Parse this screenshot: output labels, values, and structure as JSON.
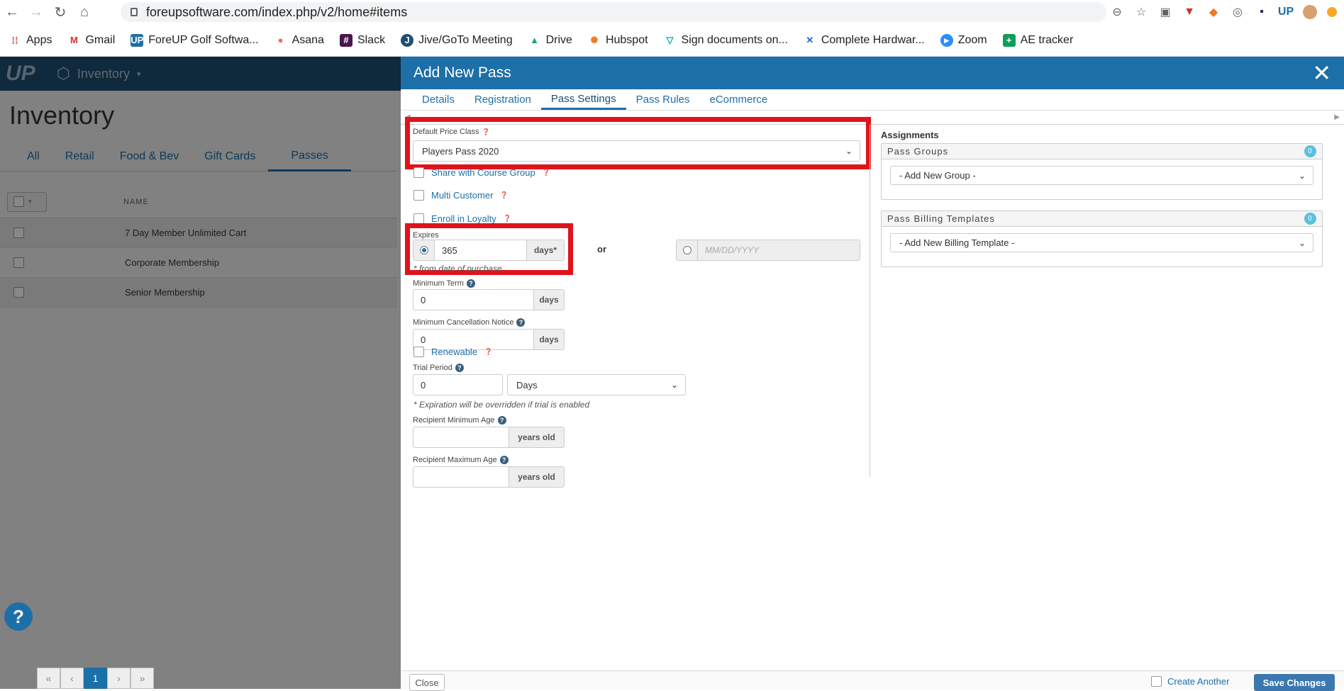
{
  "browser": {
    "url": "foreupsoftware.com/index.php/v2/home#items",
    "bookmarks": [
      "Apps",
      "Gmail",
      "ForeUP Golf Softwa...",
      "Asana",
      "Slack",
      "Jive/GoTo Meeting",
      "Drive",
      "Hubspot",
      "Sign documents on...",
      "Complete Hardwar...",
      "Zoom",
      "AE tracker"
    ]
  },
  "app": {
    "logo": "UP",
    "module_menu": "Inventory",
    "page_title": "Inventory",
    "category_tabs": [
      "All",
      "Retail",
      "Food & Bev",
      "Gift Cards",
      "Passes"
    ],
    "table": {
      "column_name": "NAME",
      "rows": [
        "7 Day Member Unlimited Cart",
        "Corporate Membership",
        "Senior Membership"
      ]
    },
    "pagination": {
      "current_page": "1"
    },
    "help": "?"
  },
  "modal": {
    "title": "Add New Pass",
    "tabs": [
      "Details",
      "Registration",
      "Pass Settings",
      "Pass Rules",
      "eCommerce"
    ],
    "default_price_class": {
      "label": "Default Price Class",
      "value": "Players Pass 2020"
    },
    "share_with_course_group": "Share with Course Group",
    "multi_customer": "Multi Customer",
    "enroll_in_loyalty": "Enroll in Loyalty",
    "expires": {
      "label": "Expires",
      "days_value": "365",
      "days_addon": "days*",
      "or": "or",
      "date_placeholder": "MM/DD/YYYY",
      "note": "* from date of purchase"
    },
    "minimum_term": {
      "label": "Minimum Term",
      "value": "0",
      "addon": "days"
    },
    "minimum_cancellation_notice": {
      "label": "Minimum Cancellation Notice",
      "value": "0",
      "addon": "days"
    },
    "renewable": "Renewable",
    "trial_period": {
      "label": "Trial Period",
      "value": "0",
      "unit": "Days",
      "note": "* Expiration will be overridden if trial is enabled"
    },
    "recipient_min_age": {
      "label": "Recipient Minimum Age",
      "value": "",
      "addon": "years old"
    },
    "recipient_max_age": {
      "label": "Recipient Maximum Age",
      "value": "",
      "addon": "years old"
    },
    "assignments": {
      "heading": "Assignments",
      "pass_groups": {
        "title": "Pass Groups",
        "count": "0",
        "select": "- Add New Group -"
      },
      "billing_templates": {
        "title": "Pass Billing Templates",
        "count": "0",
        "select": "- Add New Billing Template -"
      }
    },
    "footer": {
      "close": "Close",
      "create_another": "Create Another",
      "save": "Save Changes"
    }
  }
}
